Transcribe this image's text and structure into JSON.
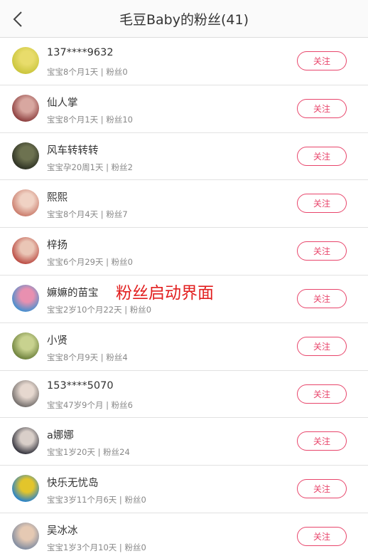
{
  "header": {
    "title": "毛豆Baby的粉丝(41)",
    "back_icon": "chevron-left-icon"
  },
  "follow_label": "关注",
  "overlay_text": "粉丝启动界面",
  "colors": {
    "accent": "#e8456b",
    "overlay": "#e21f1f"
  },
  "users": [
    {
      "name": "137****9632",
      "meta": "宝宝8个月1天 | 粉丝0",
      "avatar_color": [
        "#c9c43a",
        "#e8dc6b"
      ]
    },
    {
      "name": "仙人掌",
      "meta": "宝宝8个月1天 | 粉丝10",
      "avatar_color": [
        "#8a3b3b",
        "#d8a7a0"
      ]
    },
    {
      "name": "风车转转转",
      "meta": "宝宝孕20周1天 | 粉丝2",
      "avatar_color": [
        "#2b2f22",
        "#6d7250"
      ]
    },
    {
      "name": "熙熙",
      "meta": "宝宝8个月4天 | 粉丝7",
      "avatar_color": [
        "#c97a6a",
        "#f0d2c4"
      ]
    },
    {
      "name": "梓扬",
      "meta": "宝宝6个月29天 | 粉丝0",
      "avatar_color": [
        "#b9473f",
        "#eac6b6"
      ]
    },
    {
      "name": "嫲嫲的苗宝",
      "meta": "宝宝2岁10个月22天 | 粉丝0",
      "avatar_color": [
        "#3f8fd0",
        "#e890b0"
      ]
    },
    {
      "name": "小贤",
      "meta": "宝宝8个月9天 | 粉丝4",
      "avatar_color": [
        "#6b7f3a",
        "#c8d28f"
      ]
    },
    {
      "name": "153****5070",
      "meta": "宝宝47岁9个月 | 粉丝6",
      "avatar_color": [
        "#6f6a68",
        "#e6d8cf"
      ]
    },
    {
      "name": "a娜娜",
      "meta": "宝宝1岁20天 | 粉丝24",
      "avatar_color": [
        "#2e2e38",
        "#d9cfc9"
      ]
    },
    {
      "name": "快乐无忧岛",
      "meta": "宝宝3岁11个月6天 | 粉丝0",
      "avatar_color": [
        "#1f7fd0",
        "#e3c52b"
      ]
    },
    {
      "name": "吴冰冰",
      "meta": "宝宝1岁3个月10天 | 粉丝0",
      "avatar_color": [
        "#7d8aa0",
        "#e5c9b3"
      ]
    }
  ]
}
